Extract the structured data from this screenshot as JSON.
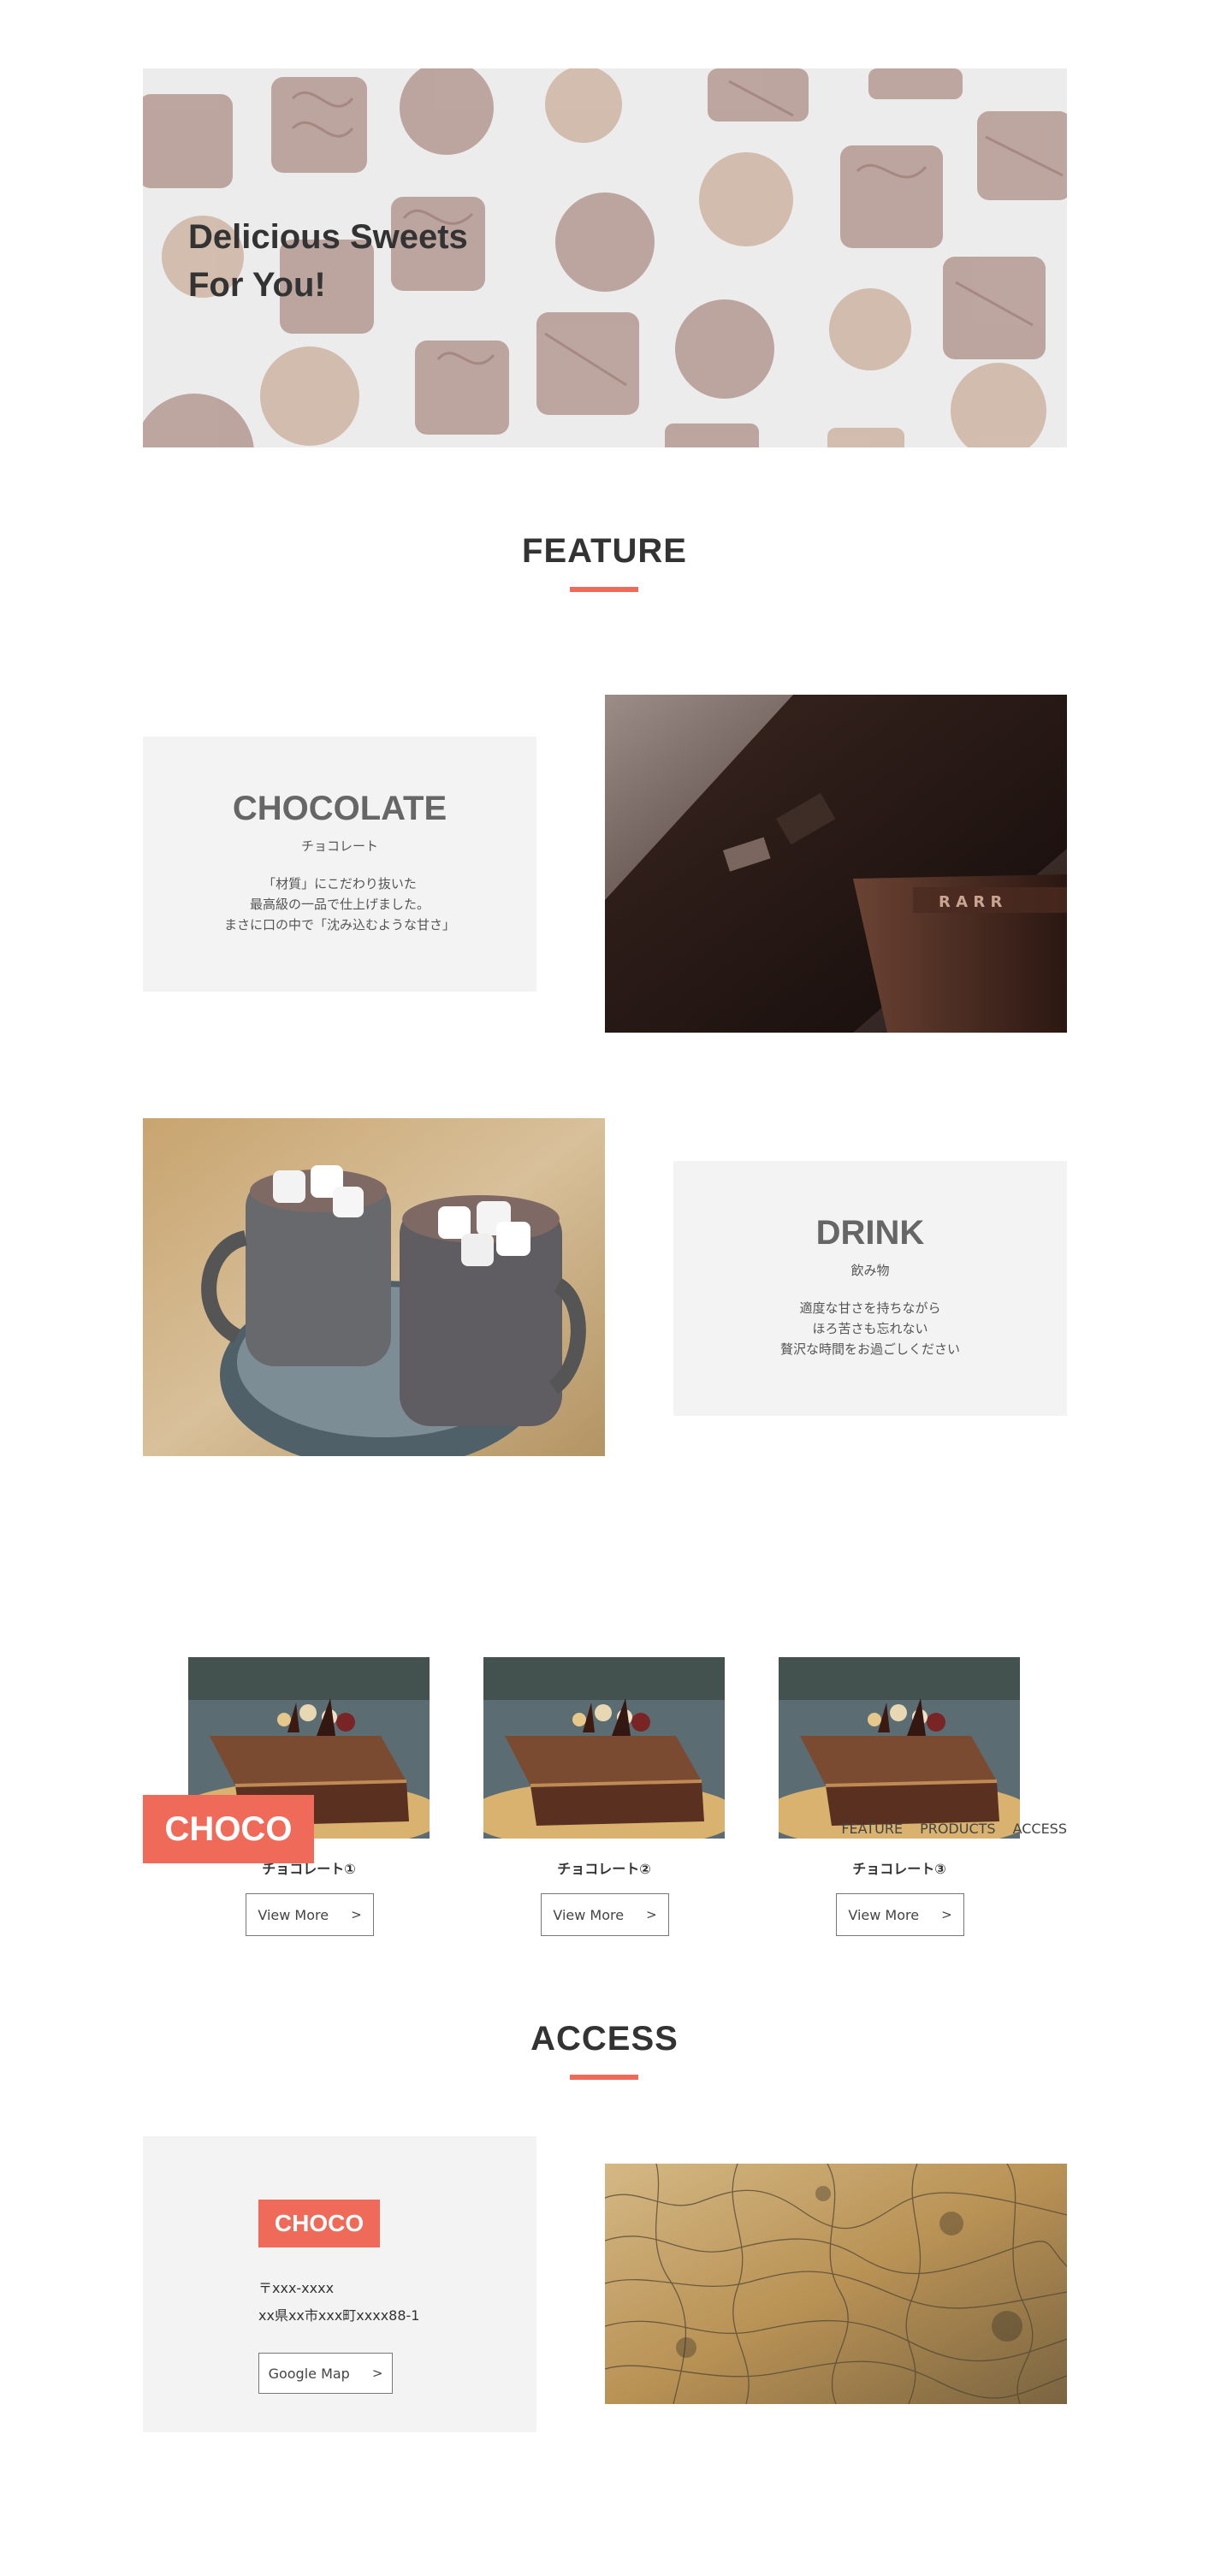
{
  "hero": {
    "title": "Delicious Sweets\nFor You!"
  },
  "feature": {
    "title": "FEATURE",
    "items": [
      {
        "title": "CHOCOLATE",
        "subtitle": "チョコレート",
        "description": "「材質」にこだわり抜いた\n最高級の一品で仕上げました。\nまさに口の中で「沈み込むような甘さ」"
      },
      {
        "title": "DRINK",
        "subtitle": "飲み物",
        "description": "適度な甘さを持ちながら\nほろ苦さも忘れない\n贅沢な時間をお過ごしください"
      }
    ]
  },
  "products": {
    "badge": "CHOCO",
    "nav": [
      "FEATURE",
      "PRODUCTS",
      "ACCESS"
    ],
    "items": [
      {
        "name": "チョコレート①",
        "button": "View More",
        "arrow": ">"
      },
      {
        "name": "チョコレート②",
        "button": "View More",
        "arrow": ">"
      },
      {
        "name": "チョコレート③",
        "button": "View More",
        "arrow": ">"
      }
    ]
  },
  "access": {
    "title": "ACCESS",
    "logo": "CHOCO",
    "postal": "〒xxx-xxxx",
    "address": "xx県xx市xxx町xxxx88-1",
    "map_button": "Google Map",
    "map_arrow": ">"
  },
  "colors": {
    "accent": "#ef6a59",
    "card_bg": "#f3f3f3",
    "text": "#333333"
  }
}
